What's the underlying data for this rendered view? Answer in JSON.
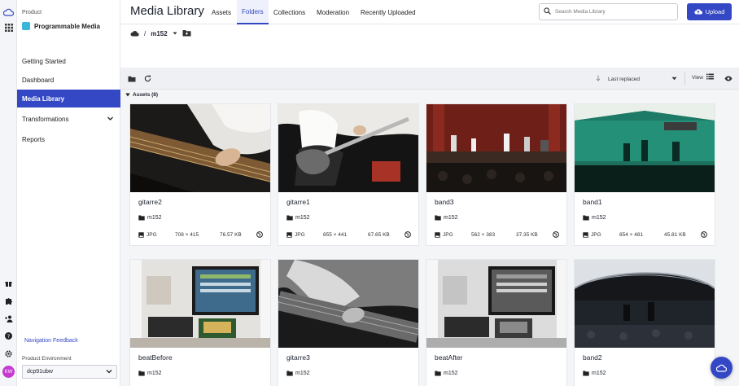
{
  "sidebar": {
    "product_label": "Product",
    "product_name": "Programmable Media",
    "nav": [
      {
        "label": "Getting Started"
      },
      {
        "label": "Dashboard"
      },
      {
        "label": "Media Library"
      },
      {
        "label": "Transformations"
      },
      {
        "label": "Reports"
      }
    ],
    "feedback": "Navigation Feedback",
    "env_label": "Product Environment",
    "env_value": "dcp91ubw",
    "avatar": "KW"
  },
  "header": {
    "title": "Media Library",
    "tabs": [
      "Assets",
      "Folders",
      "Collections",
      "Moderation",
      "Recently Uploaded"
    ],
    "active_tab": "Folders",
    "search_placeholder": "Search Media Library",
    "upload_label": "Upload"
  },
  "breadcrumb": {
    "folder": "m152"
  },
  "toolbar": {
    "sort_label": "Last replaced",
    "view_label": "View"
  },
  "assets_header": "Assets (8)",
  "assets": [
    {
      "name": "gitarre2",
      "folder": "m152",
      "format": "JPG",
      "dims": "708 × 415",
      "size": "76.57 KB"
    },
    {
      "name": "gitarre1",
      "folder": "m152",
      "format": "JPG",
      "dims": "855 × 441",
      "size": "67.65 KB"
    },
    {
      "name": "band3",
      "folder": "m152",
      "format": "JPG",
      "dims": "562 × 383",
      "size": "37.35 KB"
    },
    {
      "name": "band1",
      "folder": "m152",
      "format": "JPG",
      "dims": "854 × 481",
      "size": "45.81 KB"
    },
    {
      "name": "beatBefore",
      "folder": "m152",
      "format": "",
      "dims": "",
      "size": ""
    },
    {
      "name": "gitarre3",
      "folder": "m152",
      "format": "",
      "dims": "",
      "size": ""
    },
    {
      "name": "beatAfter",
      "folder": "m152",
      "format": "",
      "dims": "",
      "size": ""
    },
    {
      "name": "band2",
      "folder": "m152",
      "format": "",
      "dims": "",
      "size": ""
    }
  ],
  "colors": {
    "accent": "#3448c5",
    "active_tab_bg": "#eef1fb"
  }
}
